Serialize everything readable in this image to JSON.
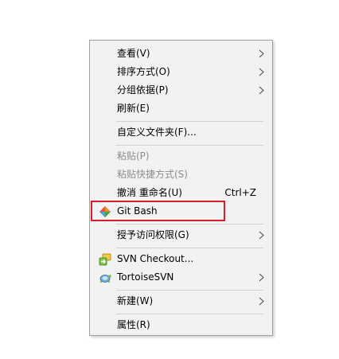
{
  "menu": {
    "items": [
      {
        "label": "查看(V)"
      },
      {
        "label": "排序方式(O)"
      },
      {
        "label": "分组依据(P)"
      },
      {
        "label": "刷新(E)"
      },
      {
        "label": "自定义文件夹(F)..."
      },
      {
        "label": "粘贴(P)"
      },
      {
        "label": "粘贴快捷方式(S)"
      },
      {
        "label": "撤消 重命名(U)",
        "shortcut": "Ctrl+Z"
      },
      {
        "label": "Git Bash"
      },
      {
        "label": "授予访问权限(G)"
      },
      {
        "label": "SVN Checkout..."
      },
      {
        "label": "TortoiseSVN"
      },
      {
        "label": "新建(W)"
      },
      {
        "label": "属性(R)"
      }
    ]
  },
  "icons": {
    "git_bash": "git-bash-icon",
    "svn_checkout": "svn-checkout-icon",
    "tortoisesvn": "tortoisesvn-icon",
    "submenu": "chevron-right-icon"
  },
  "colors": {
    "menu_background": "#f2f2f2",
    "separator": "#cfcfcf",
    "disabled_text": "#8d8d8d",
    "highlight_border": "#d91c29"
  }
}
